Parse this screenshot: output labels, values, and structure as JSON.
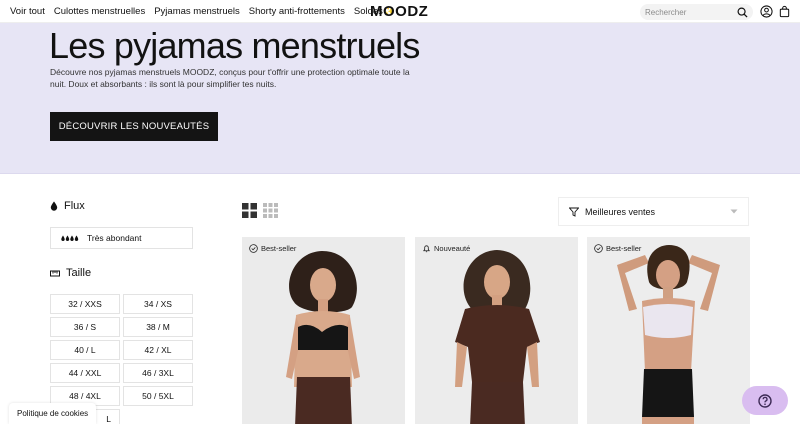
{
  "nav": {
    "links": [
      "Voir tout",
      "Culottes menstruelles",
      "Pyjamas menstruels",
      "Shorty anti-frottements",
      "Soldes"
    ],
    "logo": "MOODZ",
    "search_placeholder": "Rechercher",
    "icons": [
      "search-icon",
      "account-icon",
      "cart-icon"
    ]
  },
  "hero": {
    "title": "Les pyjamas menstruels",
    "description": "Découvre nos pyjamas menstruels MOODZ, conçus pour t'offrir une protection optimale toute la nuit. Doux et absorbants : ils sont là pour simplifier tes nuits.",
    "cta": "DÉCOUVRIR LES NOUVEAUTÉS",
    "background": "#e7e5f5"
  },
  "filters": {
    "flux": {
      "title": "Flux",
      "option": "Très abondant"
    },
    "taille": {
      "title": "Taille",
      "sizes": [
        "32 / XXS",
        "34 / XS",
        "36 / S",
        "38 / M",
        "40 / L",
        "42 / XL",
        "44 / XXL",
        "46 / 3XL",
        "48 / 4XL",
        "50 / 5XL",
        "L"
      ]
    }
  },
  "sort": {
    "label": "Meilleures ventes"
  },
  "products": [
    {
      "badge": "Best-seller",
      "badge_icon": "check-circle-icon",
      "top_color": "#1a1a1a",
      "bottom_color": "#4a2a22"
    },
    {
      "badge": "Nouveauté",
      "badge_icon": "bell-icon",
      "top_color": "#4b2a20",
      "bottom_color": "#4a2a22"
    },
    {
      "badge": "Best-seller",
      "badge_icon": "check-circle-icon",
      "top_color": "#eae6ef",
      "bottom_color": "#151515"
    }
  ],
  "cookie": "Politique de cookies",
  "colors": {
    "accent": "#141414",
    "help_bg": "#d9bdf0"
  }
}
